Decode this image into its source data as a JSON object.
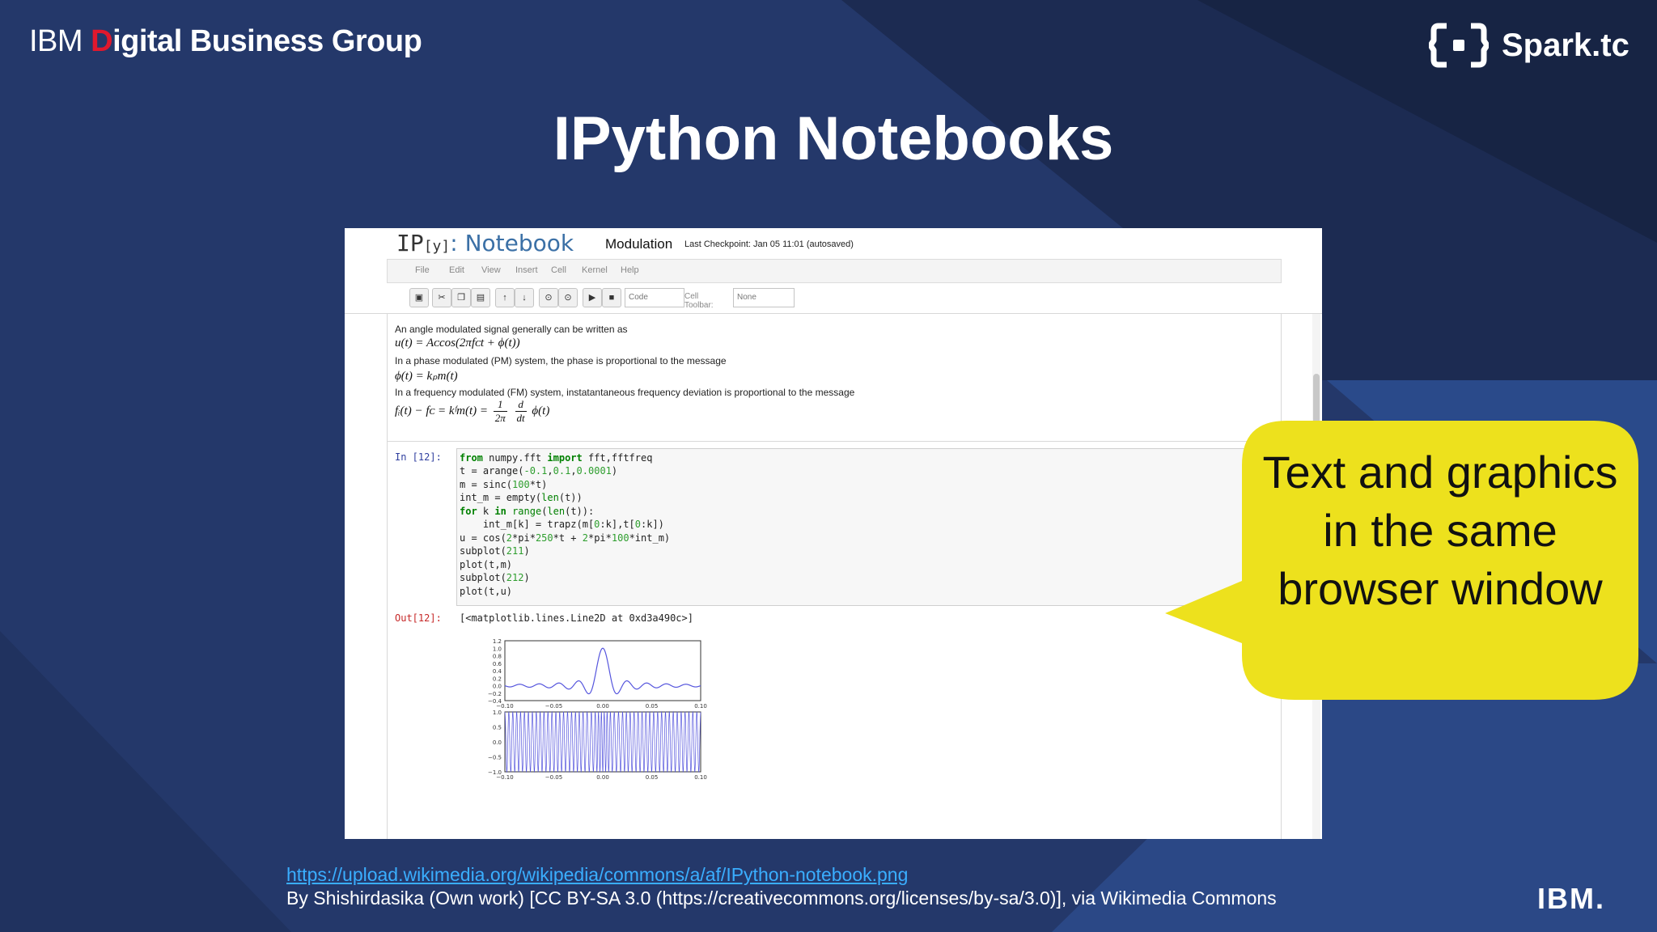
{
  "header": {
    "brand_ibm": "IBM ",
    "brand_d": "D",
    "brand_rest": "igital Business Group",
    "partner_logo_text": "Spark.tc"
  },
  "slide": {
    "title": "IPython Notebooks"
  },
  "notebook": {
    "logo_ip": "IP",
    "logo_y": "[y]",
    "logo_suffix": ": Notebook",
    "name": "Modulation",
    "checkpoint": "Last Checkpoint: Jan 05 11:01 (autosaved)",
    "menu": [
      "File",
      "Edit",
      "View",
      "Insert",
      "Cell",
      "Kernel",
      "Help"
    ],
    "toolbar": {
      "cell_type": "Code",
      "cell_toolbar_label": "Cell Toolbar:",
      "cell_toolbar_value": "None"
    },
    "markdown": {
      "line1": "An angle modulated signal generally can be written as",
      "eq1": "u(t) = Aᴄcos(2πfᴄt + ϕ(t))",
      "line2": "In a phase modulated (PM) system, the phase is proportional to the message",
      "eq2": "ϕ(t) = kₚm(t)",
      "line3": "In a frequency modulated (FM) system, instatantaneous frequency deviation is proportional to the message",
      "eq3_left": "fᵢ(t) − fᴄ = kᶠm(t) =",
      "eq3_frac1_num": "1",
      "eq3_frac1_den": "2π",
      "eq3_frac2_num": "d",
      "eq3_frac2_den": "dt",
      "eq3_right": "ϕ(t)"
    },
    "cell_in_prompt": "In [12]:",
    "cell_out_prompt": "Out[12]:",
    "output_text": "[<matplotlib.lines.Line2D at 0xd3a490c>]"
  },
  "chart_data": [
    {
      "type": "line",
      "x_ticks": [
        "−0.10",
        "−0.05",
        "0.00",
        "0.05",
        "0.10"
      ],
      "y_ticks": [
        "1.2",
        "1.0",
        "0.8",
        "0.6",
        "0.4",
        "0.2",
        "0.0",
        "−0.2",
        "−0.4"
      ],
      "xlim": [
        -0.1,
        0.1
      ],
      "ylim": [
        -0.4,
        1.2
      ],
      "series_color": "#5555dd"
    },
    {
      "type": "line",
      "x_ticks": [
        "−0.10",
        "−0.05",
        "0.00",
        "0.05",
        "0.10"
      ],
      "y_ticks": [
        "1.0",
        "0.5",
        "0.0",
        "−0.5",
        "−1.0"
      ],
      "xlim": [
        -0.1,
        0.1
      ],
      "ylim": [
        -1.0,
        1.0
      ],
      "series_color": "#5555dd"
    }
  ],
  "callout": {
    "text": "Text and graphics in the same browser window",
    "color": "#ede11d"
  },
  "credit": {
    "link": "https://upload.wikimedia.org/wikipedia/commons/a/af/IPython-notebook.png",
    "text": "By Shishirdasika (Own work) [CC BY-SA 3.0 (https://creativecommons.org/licenses/by-sa/3.0)], via Wikimedia Commons"
  },
  "footer": {
    "ibm_logo": "IBM."
  },
  "colors": {
    "background": "#24386a",
    "brand_red": "#e0182d",
    "link": "#3aaeff"
  }
}
